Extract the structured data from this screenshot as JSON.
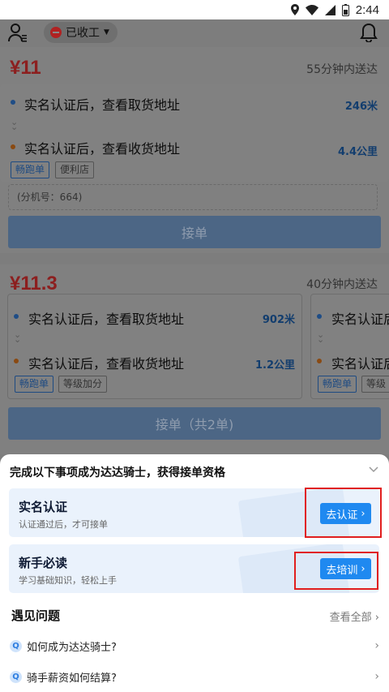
{
  "statusbar": {
    "time": "2:44"
  },
  "header": {
    "status_label": "已收工"
  },
  "orders": [
    {
      "price": "¥11",
      "eta": "55分钟内送达",
      "pickup": {
        "text": "实名认证后，查看取货地址",
        "distance": "246米"
      },
      "dropoff": {
        "text": "实名认证后，查看收货地址",
        "distance": "4.4公里"
      },
      "tags": [
        "畅跑单",
        "便利店"
      ],
      "extension": "(分机号：664)",
      "accept_label": "接单"
    },
    {
      "price": "¥11.3",
      "eta": "40分钟内送达",
      "pickup": {
        "text": "实名认证后，查看取货地址",
        "distance": "902米"
      },
      "dropoff": {
        "text": "实名认证后，查看收货地址",
        "distance": "1.2公里"
      },
      "tags": [
        "畅跑单",
        "等级加分"
      ],
      "peek": {
        "pickup": "实名认证后",
        "dropoff": "实名认证后",
        "tags": [
          "畅跑单",
          "等级"
        ]
      },
      "accept_label": "接单（共2单)"
    }
  ],
  "sheet": {
    "title": "完成以下事项成为达达骑士，获得接单资格",
    "tasks": [
      {
        "title": "实名认证",
        "subtitle": "认证通过后，才可接单",
        "button": "去认证"
      },
      {
        "title": "新手必读",
        "subtitle": "学习基础知识，轻松上手",
        "button": "去培训"
      }
    ],
    "faq_title": "遇见问题",
    "faq_all": "查看全部",
    "faq_items": [
      "如何成为达达骑士?",
      "骑手薪资如何结算?"
    ]
  },
  "colors": {
    "accent": "#1f89f0",
    "price": "#e63c3c",
    "highlight": "#e01e1e"
  }
}
